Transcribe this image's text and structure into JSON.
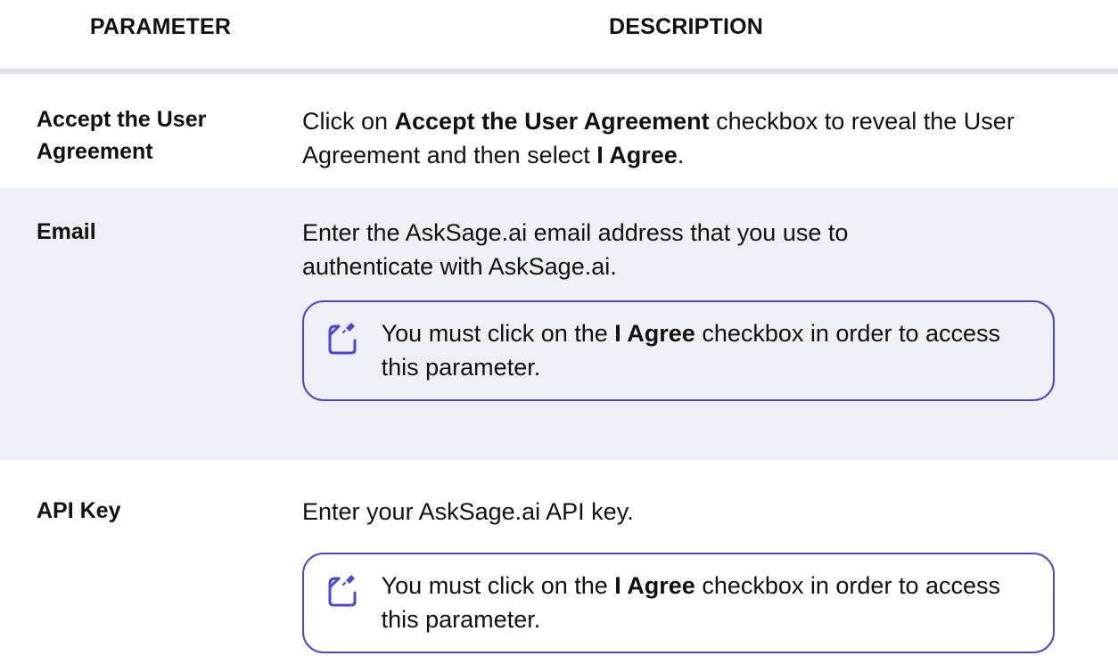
{
  "header": {
    "col1": "PARAMETER",
    "col2": "DESCRIPTION"
  },
  "rows": [
    {
      "name": "Accept the User Agreement",
      "desc": {
        "t1": "Click on ",
        "b1": "Accept the User Agreement",
        "t2": " checkbox to reveal the User Agreement and then select ",
        "b2": "I Agree",
        "t3": "."
      }
    },
    {
      "name": "Email",
      "desc": {
        "t1": "Enter the AskSage.ai email address that you use to authenticate with AskSage.ai."
      },
      "note": {
        "t1": "You must click on the ",
        "b1": "I Agree",
        "t2": " checkbox in order to access this parameter.",
        "icon": "note-icon"
      }
    },
    {
      "name": "API Key",
      "desc": {
        "t1": "Enter your AskSage.ai API key."
      },
      "note": {
        "t1": "You must click on the ",
        "b1": "I Agree",
        "t2": " checkbox in order to access this parameter.",
        "icon": "note-icon"
      }
    }
  ],
  "colors": {
    "accent": "#4a47d1",
    "shaded_row": "#eef0f6",
    "rule": "#dfe3ec"
  }
}
